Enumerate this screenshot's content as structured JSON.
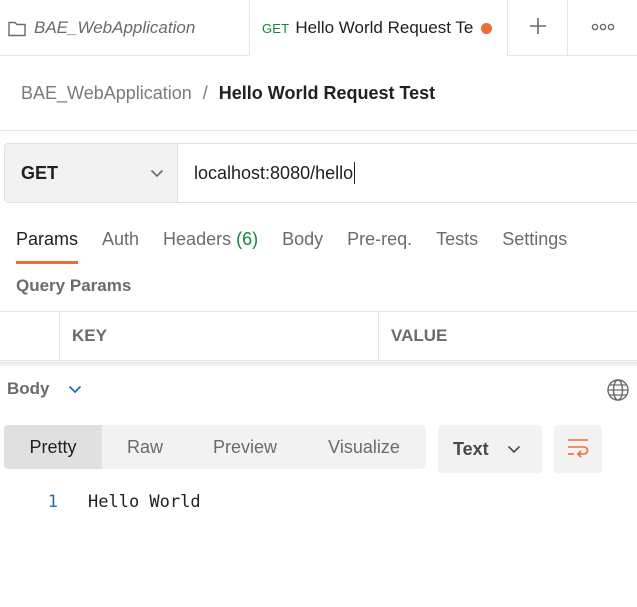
{
  "tabs": {
    "collection_tab": {
      "title": "BAE_WebApplication",
      "icon": "collection-icon"
    },
    "request_tab": {
      "method": "GET",
      "title": "Hello World Request Te",
      "unsaved": true
    },
    "add_icon": "plus-icon",
    "more_icon": "more-horizontal-icon"
  },
  "breadcrumb": {
    "parent": "BAE_WebApplication",
    "separator": "/",
    "current": "Hello World Request Test"
  },
  "request": {
    "method": "GET",
    "url": "localhost:8080/hello"
  },
  "request_tabs": [
    {
      "label": "Params",
      "active": true
    },
    {
      "label": "Auth",
      "active": false
    },
    {
      "label": "Headers",
      "count": "(6)",
      "active": false
    },
    {
      "label": "Body",
      "active": false
    },
    {
      "label": "Pre-req.",
      "active": false
    },
    {
      "label": "Tests",
      "active": false
    },
    {
      "label": "Settings",
      "active": false
    }
  ],
  "query_params": {
    "label": "Query Params",
    "columns": [
      "KEY",
      "VALUE"
    ]
  },
  "response": {
    "body_label": "Body",
    "view_modes": [
      "Pretty",
      "Raw",
      "Preview",
      "Visualize"
    ],
    "active_view": "Pretty",
    "format": "Text",
    "lines": [
      {
        "number": "1",
        "text": "Hello World"
      }
    ]
  },
  "colors": {
    "accent": "#ef6c38",
    "method_green": "#0c8a3a",
    "line_number_blue": "#2a6ea6"
  }
}
